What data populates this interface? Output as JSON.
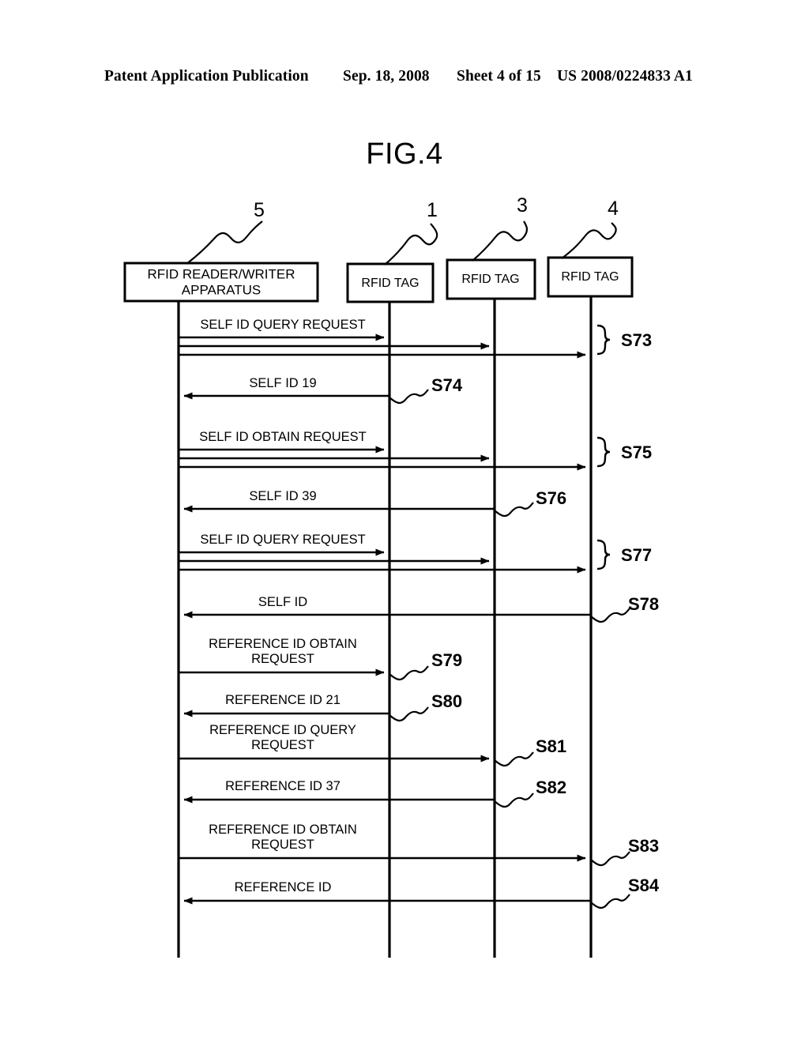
{
  "header": {
    "publication": "Patent Application Publication",
    "date": "Sep. 18, 2008",
    "sheet": "Sheet 4 of 15",
    "doc_number": "US 2008/0224833 A1"
  },
  "figure": {
    "title": "FIG.4"
  },
  "lifelines": [
    {
      "id": "reader",
      "ref": "5",
      "label_line1": "RFID READER/WRITER",
      "label_line2": "APPARATUS"
    },
    {
      "id": "tag1",
      "ref": "1",
      "label_line1": "RFID TAG",
      "label_line2": ""
    },
    {
      "id": "tag3",
      "ref": "3",
      "label_line1": "RFID TAG",
      "label_line2": ""
    },
    {
      "id": "tag4",
      "ref": "4",
      "label_line1": "RFID TAG",
      "label_line2": ""
    }
  ],
  "messages": [
    {
      "step": "S73",
      "label_line1": "SELF ID QUERY REQUEST",
      "label_line2": "",
      "marker": "brace"
    },
    {
      "step": "S74",
      "label_line1": "SELF ID 19",
      "label_line2": "",
      "marker": "squiggle"
    },
    {
      "step": "S75",
      "label_line1": "SELF ID OBTAIN REQUEST",
      "label_line2": "",
      "marker": "brace"
    },
    {
      "step": "S76",
      "label_line1": "SELF ID 39",
      "label_line2": "",
      "marker": "squiggle"
    },
    {
      "step": "S77",
      "label_line1": "SELF ID QUERY REQUEST",
      "label_line2": "",
      "marker": "brace"
    },
    {
      "step": "S78",
      "label_line1": "SELF ID",
      "label_line2": "",
      "marker": "squiggle"
    },
    {
      "step": "S79",
      "label_line1": "REFERENCE ID OBTAIN",
      "label_line2": "REQUEST",
      "marker": "squiggle"
    },
    {
      "step": "S80",
      "label_line1": "REFERENCE ID 21",
      "label_line2": "",
      "marker": "squiggle"
    },
    {
      "step": "S81",
      "label_line1": "REFERENCE ID QUERY",
      "label_line2": "REQUEST",
      "marker": "squiggle"
    },
    {
      "step": "S82",
      "label_line1": "REFERENCE ID 37",
      "label_line2": "",
      "marker": "squiggle"
    },
    {
      "step": "S83",
      "label_line1": "REFERENCE ID OBTAIN",
      "label_line2": "REQUEST",
      "marker": "squiggle"
    },
    {
      "step": "S84",
      "label_line1": "REFERENCE ID",
      "label_line2": "",
      "marker": "squiggle"
    }
  ],
  "colors": {
    "ink": "#000000",
    "paper": "#ffffff"
  }
}
